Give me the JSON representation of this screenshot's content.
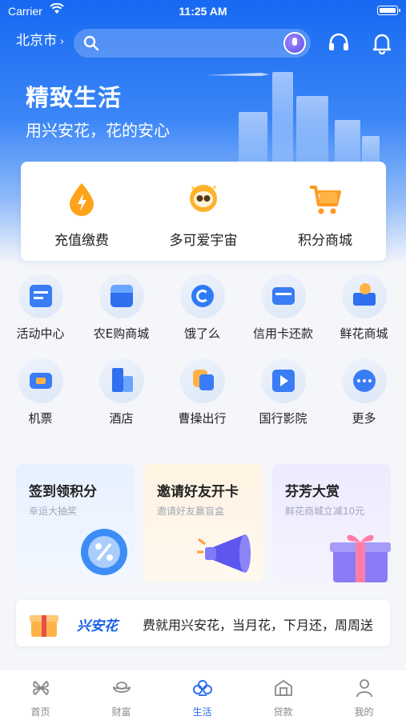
{
  "status_bar": {
    "carrier": "Carrier",
    "time": "11:25 AM"
  },
  "top_bar": {
    "city": "北京市",
    "city_chevron": "›"
  },
  "hero": {
    "title": "精致生活",
    "subtitle": "用兴安花，花的安心"
  },
  "quick_actions": [
    {
      "label": "充值缴费",
      "icon": "water-drop-bolt-icon"
    },
    {
      "label": "多可爱宇宙",
      "icon": "astronaut-icon"
    },
    {
      "label": "积分商城",
      "icon": "shopping-cart-icon"
    }
  ],
  "services": [
    {
      "label": "活动中心",
      "icon": "calendar-icon"
    },
    {
      "label": "农E购商城",
      "icon": "store-icon"
    },
    {
      "label": "饿了么",
      "icon": "eleme-icon"
    },
    {
      "label": "信用卡还款",
      "icon": "credit-card-repay-icon"
    },
    {
      "label": "鲜花商城",
      "icon": "flower-cart-icon"
    },
    {
      "label": "机票",
      "icon": "plane-ticket-icon"
    },
    {
      "label": "酒店",
      "icon": "hotel-icon"
    },
    {
      "label": "曹操出行",
      "icon": "ride-icon"
    },
    {
      "label": "国行影院",
      "icon": "cinema-icon"
    },
    {
      "label": "更多",
      "icon": "more-icon"
    }
  ],
  "promos": [
    {
      "title": "签到领积分",
      "subtitle": "幸运大抽奖",
      "icon": "percent-badge-icon"
    },
    {
      "title": "邀请好友开卡",
      "subtitle": "邀请好友赢盲盒",
      "icon": "megaphone-icon"
    },
    {
      "title": "芬芳大赏",
      "subtitle": "鲜花商城立减10元",
      "icon": "gift-box-icon"
    }
  ],
  "banner": {
    "brand": "兴安花",
    "text": "费就用兴安花，当月花，下月还，周周送"
  },
  "tabs": [
    {
      "label": "首页",
      "icon": "home-icon",
      "active": false
    },
    {
      "label": "财富",
      "icon": "wealth-icon",
      "active": false
    },
    {
      "label": "生活",
      "icon": "life-icon",
      "active": true
    },
    {
      "label": "贷款",
      "icon": "loan-icon",
      "active": false
    },
    {
      "label": "我的",
      "icon": "profile-icon",
      "active": false
    }
  ],
  "colors": {
    "primary": "#1769f2",
    "active_tab": "#2a6cf0",
    "accent_orange": "#ff9a1f"
  }
}
